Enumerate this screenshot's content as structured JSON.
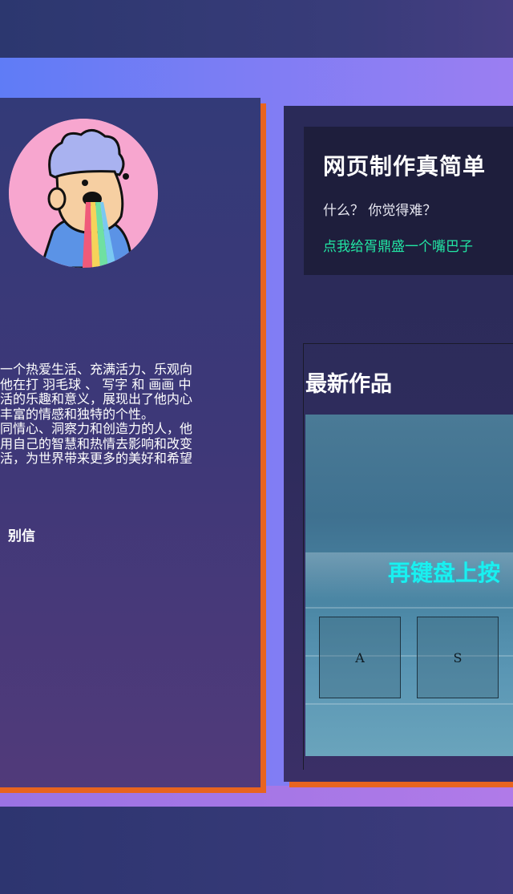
{
  "profile": {
    "bio_lines": [
      "一个热爱生活、充满活力、乐观向",
      "他在打 羽毛球 、 写字 和 画画 中",
      "活的乐趣和意义，展现出了他内心",
      "丰富的情感和独特的个性。",
      "同情心、洞察力和创造力的人，他",
      "用自己的智慧和热情去影响和改变",
      "活，为世界带来更多的美好和希望"
    ],
    "signature": "别信"
  },
  "intro": {
    "title": "网页制作真简单",
    "subtitle": "什么？ 你觉得难？",
    "link": "点我给胥鼎盛一个嘴巴子"
  },
  "works": {
    "title": "最新作品",
    "preview_text": "再键盘上按",
    "keys": [
      "A",
      "S"
    ]
  },
  "colors": {
    "accent_shadow": "#e8641f",
    "link_green": "#22e6a4",
    "preview_text_cyan": "#19f0f0"
  }
}
